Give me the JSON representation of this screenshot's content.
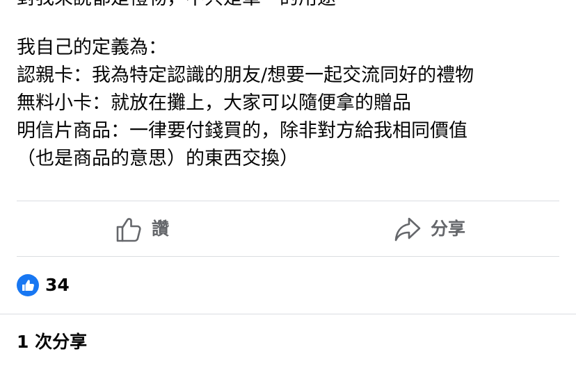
{
  "post": {
    "text_cut_line": "對我來說都是禮物，不只是單一的用途",
    "lines": [
      "我自己的定義為：",
      "認親卡：我為特定認識的朋友/想要一起交流同好的禮物",
      "無料小卡：就放在攤上，大家可以隨便拿的贈品",
      "明信片商品：一律要付錢買的，除非對方給我相同價值",
      "（也是商品的意思）的東西交換）"
    ]
  },
  "actions": {
    "like_label": "讚",
    "like_icon": "thumbs-up-outline-icon",
    "share_label": "分享",
    "share_icon": "share-arrow-icon"
  },
  "reactions": {
    "icon": "like-reaction-icon",
    "count": "34"
  },
  "shares": {
    "label": "1 次分享"
  },
  "colors": {
    "accent": "#1877f2",
    "muted_text": "#65676b",
    "divider": "#dadde1",
    "text": "#050505"
  }
}
